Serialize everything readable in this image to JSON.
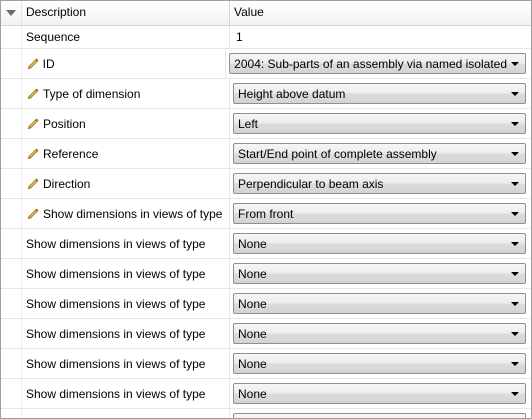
{
  "columns": {
    "description": "Description",
    "value": "Value"
  },
  "rows": [
    {
      "description": "Sequence",
      "value": "1",
      "editable": false,
      "kind": "text"
    },
    {
      "description": "ID",
      "value": "2004: Sub-parts of an assembly via named isolated",
      "editable": true,
      "kind": "combo"
    },
    {
      "description": "Type of dimension",
      "value": "Height above datum",
      "editable": true,
      "kind": "combo"
    },
    {
      "description": "Position",
      "value": "Left",
      "editable": true,
      "kind": "combo"
    },
    {
      "description": "Reference",
      "value": "Start/End point of complete assembly",
      "editable": true,
      "kind": "combo"
    },
    {
      "description": "Direction",
      "value": "Perpendicular to beam axis",
      "editable": true,
      "kind": "combo"
    },
    {
      "description": "Show dimensions in views of type",
      "value": "From front",
      "editable": true,
      "kind": "combo"
    },
    {
      "description": "Show dimensions in views of type",
      "value": "None",
      "editable": false,
      "kind": "combo"
    },
    {
      "description": "Show dimensions in views of type",
      "value": "None",
      "editable": false,
      "kind": "combo"
    },
    {
      "description": "Show dimensions in views of type",
      "value": "None",
      "editable": false,
      "kind": "combo"
    },
    {
      "description": "Show dimensions in views of type",
      "value": "None",
      "editable": false,
      "kind": "combo"
    },
    {
      "description": "Show dimensions in views of type",
      "value": "None",
      "editable": false,
      "kind": "combo"
    },
    {
      "description": "Show dimensions in views of type",
      "value": "None",
      "editable": false,
      "kind": "combo"
    },
    {
      "description": "Show dimensions in views of type",
      "value": "None",
      "editable": false,
      "kind": "combo"
    }
  ],
  "icons": {
    "edit": "pencil-icon",
    "dropdown": "chevron-down-icon",
    "expander": "triangle-down-icon"
  }
}
